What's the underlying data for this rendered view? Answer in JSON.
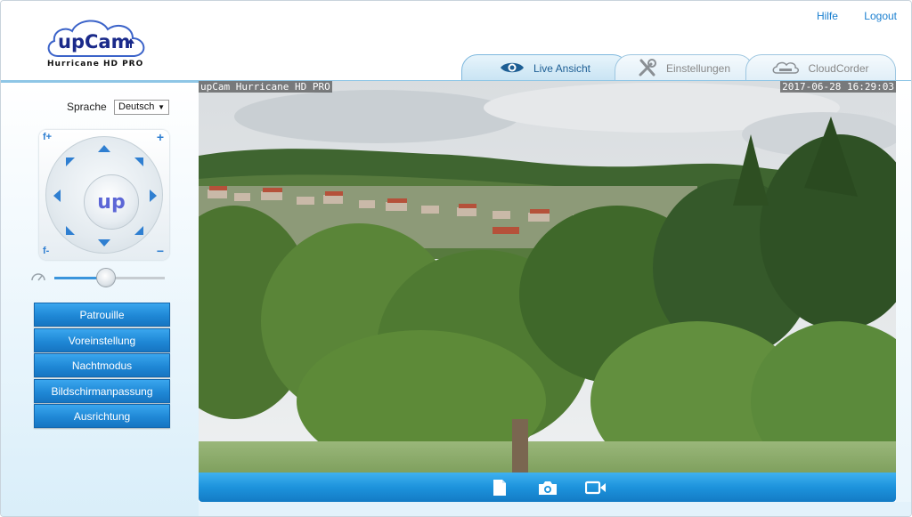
{
  "header": {
    "logo": {
      "brand_main": "upCam",
      "brand_sub": "Hurricane HD PRO"
    },
    "links": {
      "help": "Hilfe",
      "logout": "Logout"
    },
    "tabs": [
      {
        "label": "Live Ansicht",
        "icon": "eye-icon",
        "active": true
      },
      {
        "label": "Einstellungen",
        "icon": "tools-icon",
        "active": false
      },
      {
        "label": "CloudCorder",
        "icon": "cloud-icon",
        "active": false
      }
    ]
  },
  "sidebar": {
    "language_label": "Sprache",
    "language_value": "Deutsch",
    "ptz": {
      "center_label": "up",
      "focus_plus": "f+",
      "focus_minus": "f-",
      "zoom_plus": "+",
      "zoom_minus": "−"
    },
    "speed_slider_level": 0.47,
    "buttons": [
      "Patrouille",
      "Voreinstellung",
      "Nachtmodus",
      "Bildschirmanpassung",
      "Ausrichtung"
    ]
  },
  "video": {
    "osd_camera_name": "upCam Hurricane HD PRO",
    "osd_timestamp": "2017-06-28 16:29:03"
  },
  "toolbar": {
    "icons": [
      "record-file-icon",
      "snapshot-camera-icon",
      "video-record-icon"
    ]
  },
  "colors": {
    "accent": "#1f88d6",
    "header_line": "#8ec6e6",
    "link": "#1a7fd0"
  }
}
